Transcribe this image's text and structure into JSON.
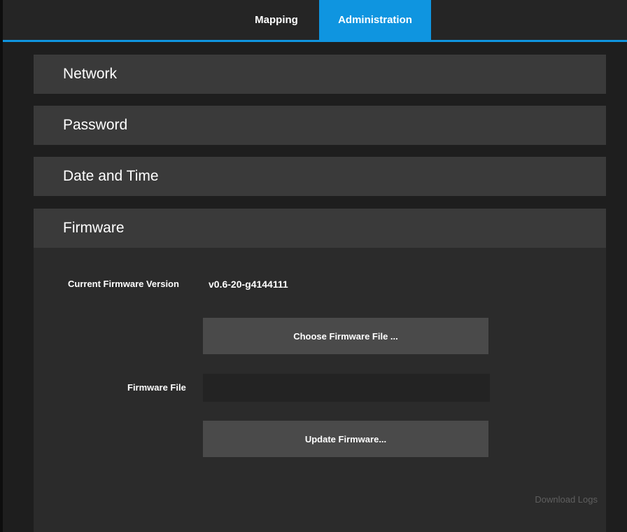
{
  "nav": {
    "tabs": [
      {
        "label": "Mapping",
        "active": false
      },
      {
        "label": "Administration",
        "active": true
      }
    ],
    "accent_color": "#0f95e0"
  },
  "sections": {
    "network": {
      "title": "Network"
    },
    "password": {
      "title": "Password"
    },
    "datetime": {
      "title": "Date and Time"
    },
    "firmware": {
      "title": "Firmware",
      "current_version_label": "Current Firmware Version",
      "current_version_value": "v0.6-20-g4144111",
      "choose_button_label": "Choose Firmware File ...",
      "file_label": "Firmware File",
      "file_value": "",
      "update_button_label": "Update Firmware...",
      "download_logs_label": "Download Logs"
    }
  }
}
